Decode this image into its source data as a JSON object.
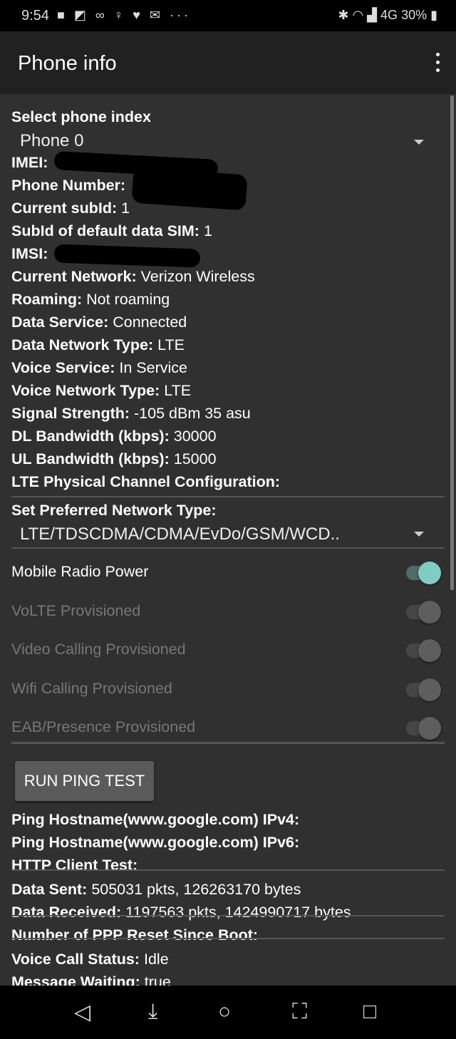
{
  "status_bar": {
    "time": "9:54",
    "battery": "30%",
    "network": "4G"
  },
  "app_bar": {
    "title": "Phone info"
  },
  "phone_index": {
    "label": "Select phone index",
    "value": "Phone 0"
  },
  "info": [
    {
      "label": "IMEI:",
      "value": ""
    },
    {
      "label": "Phone Number:",
      "value": ""
    },
    {
      "label": "Current subId:",
      "value": "1"
    },
    {
      "label": "SubId of default data SIM:",
      "value": "1"
    },
    {
      "label": "IMSI:",
      "value": ""
    },
    {
      "label": "Current Network:",
      "value": "Verizon Wireless"
    },
    {
      "label": "Roaming:",
      "value": "Not roaming"
    },
    {
      "label": "Data Service:",
      "value": "Connected"
    },
    {
      "label": "Data Network Type:",
      "value": "LTE"
    },
    {
      "label": "Voice Service:",
      "value": "In Service"
    },
    {
      "label": "Voice Network Type:",
      "value": "LTE"
    },
    {
      "label": "Signal Strength:",
      "value": "-105 dBm   35 asu"
    },
    {
      "label": "DL Bandwidth (kbps):",
      "value": "30000"
    },
    {
      "label": "UL Bandwidth (kbps):",
      "value": "15000"
    },
    {
      "label": "LTE Physical Channel Configuration:",
      "value": ""
    }
  ],
  "preferred_network": {
    "label": "Set Preferred Network Type:",
    "value": "LTE/TDSCDMA/CDMA/EvDo/GSM/WCD.."
  },
  "toggles": [
    {
      "label": "Mobile Radio Power",
      "on": true,
      "enabled": true
    },
    {
      "label": "VoLTE Provisioned",
      "on": true,
      "enabled": false
    },
    {
      "label": "Video Calling Provisioned",
      "on": true,
      "enabled": false
    },
    {
      "label": "Wifi Calling Provisioned",
      "on": true,
      "enabled": false
    },
    {
      "label": "EAB/Presence Provisioned",
      "on": true,
      "enabled": false
    }
  ],
  "ping_button": "RUN PING TEST",
  "results": [
    {
      "label": "Ping Hostname(www.google.com) IPv4:",
      "value": ""
    },
    {
      "label": "Ping Hostname(www.google.com) IPv6:",
      "value": ""
    },
    {
      "label": "HTTP Client Test:",
      "value": ""
    },
    {
      "label": "Data Sent:",
      "value": "505031 pkts, 126263170 bytes"
    },
    {
      "label": "Data Received:",
      "value": "1197563 pkts, 1424990717 bytes"
    },
    {
      "label": "Number of PPP Reset Since Boot:",
      "value": ""
    },
    {
      "label": "Voice Call Status:",
      "value": "Idle"
    },
    {
      "label": "Message Waiting:",
      "value": "true"
    }
  ],
  "colors": {
    "accent": "#80cbc4",
    "background": "#303030",
    "app_bar": "#212121"
  }
}
